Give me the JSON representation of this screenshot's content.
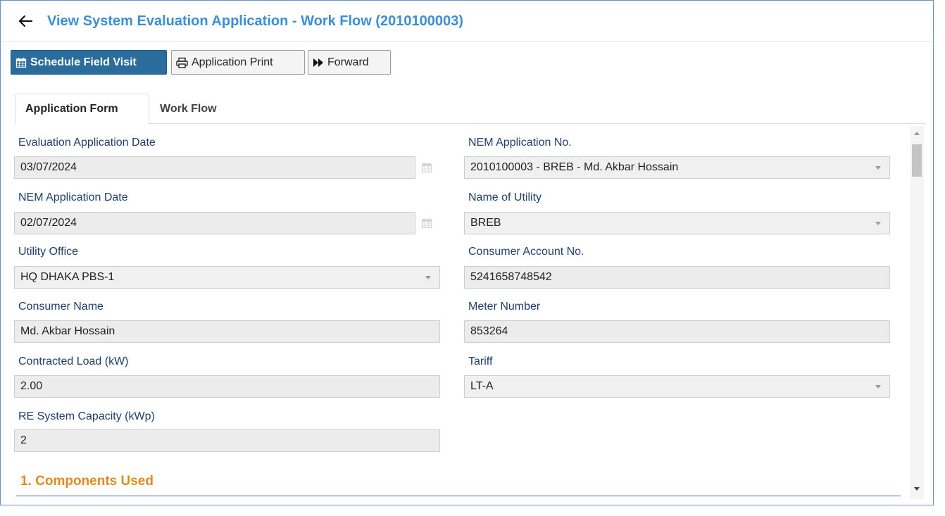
{
  "header": {
    "title": "View System Evaluation Application - Work Flow (2010100003)",
    "back_icon": "arrow-left-icon"
  },
  "toolbar": {
    "schedule_label": "Schedule Field Visit",
    "print_label": "Application Print",
    "forward_label": "Forward"
  },
  "tabs": [
    {
      "label": "Application Form",
      "active": true
    },
    {
      "label": "Work Flow",
      "active": false
    }
  ],
  "form": {
    "eval_date": {
      "label": "Evaluation Application Date",
      "value": "03/07/2024"
    },
    "nem_app_no": {
      "label": "NEM Application No.",
      "value": "2010100003 - BREB - Md. Akbar Hossain"
    },
    "nem_app_date": {
      "label": "NEM Application Date",
      "value": "02/07/2024"
    },
    "utility_name": {
      "label": "Name of Utility",
      "value": "BREB"
    },
    "utility_office": {
      "label": "Utility Office",
      "value": "HQ DHAKA PBS-1"
    },
    "consumer_account": {
      "label": "Consumer Account No.",
      "value": "5241658748542"
    },
    "consumer_name": {
      "label": "Consumer Name",
      "value": "Md. Akbar Hossain"
    },
    "meter_number": {
      "label": "Meter Number",
      "value": "853264"
    },
    "contracted_load": {
      "label": "Contracted Load (kW)",
      "value": "2.00"
    },
    "tariff": {
      "label": "Tariff",
      "value": "LT-A"
    },
    "re_capacity": {
      "label": "RE System Capacity (kWp)",
      "value": "2"
    }
  },
  "section": {
    "title": "1. Components Used"
  },
  "colors": {
    "title_blue": "#3a8fd6",
    "primary_button": "#2a6d9c",
    "label_navy": "#1f3f6a",
    "section_orange": "#e08a1e"
  }
}
